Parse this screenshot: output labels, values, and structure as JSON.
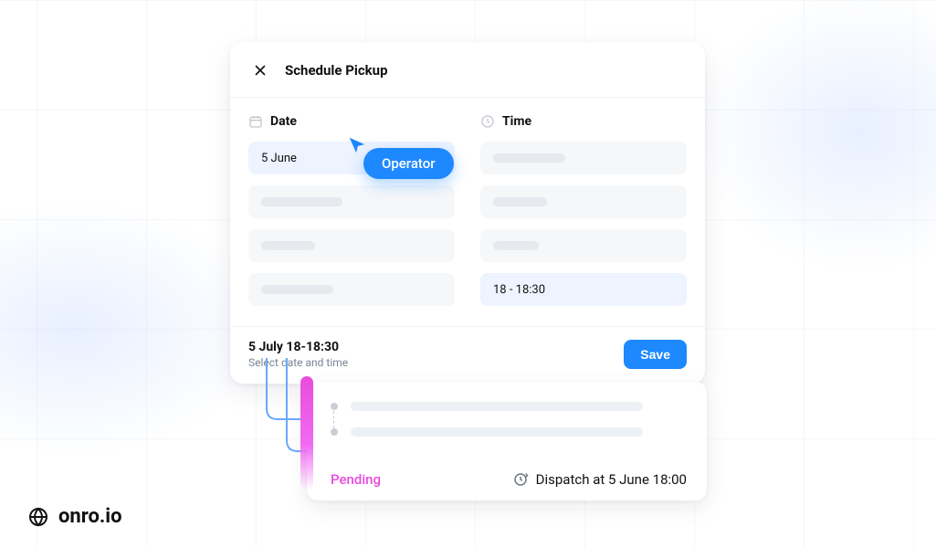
{
  "brand": {
    "name": "onro.io"
  },
  "panel": {
    "title": "Schedule Pickup",
    "date_section": {
      "label": "Date",
      "rows": [
        {
          "value": "5 June",
          "selected": true
        },
        {
          "value": "",
          "selected": false
        },
        {
          "value": "",
          "selected": false
        },
        {
          "value": "",
          "selected": false
        }
      ]
    },
    "time_section": {
      "label": "Time",
      "rows": [
        {
          "value": "",
          "selected": false
        },
        {
          "value": "",
          "selected": false
        },
        {
          "value": "",
          "selected": false
        },
        {
          "value": "18 - 18:30",
          "selected": true
        }
      ]
    },
    "footer": {
      "summary": "5 July 18-18:30",
      "hint": "Select date and time",
      "save_label": "Save"
    }
  },
  "cursor": {
    "tooltip": "Operator"
  },
  "task_card": {
    "status": "Pending",
    "dispatch_label": "Dispatch at 5 June 18:00"
  },
  "colors": {
    "accent": "#1e88ff",
    "status_magenta": "#e94bdb"
  }
}
